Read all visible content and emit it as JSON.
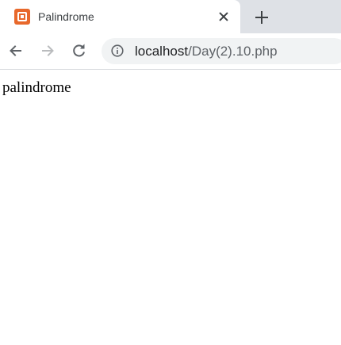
{
  "tab": {
    "title": "Palindrome",
    "favicon": "xampp-favicon-icon",
    "favicon_color": "#e8682b"
  },
  "toolbar": {
    "back_icon": "arrow-left-icon",
    "forward_icon": "arrow-right-icon",
    "reload_icon": "reload-icon",
    "info_icon": "info-icon",
    "url_host": "localhost",
    "url_path": "/Day(2).10.php"
  },
  "page": {
    "text": "palindrome"
  },
  "colors": {
    "tabstrip": "#dee1e6",
    "omnibox": "#f1f3f4",
    "icon": "#5f6368"
  }
}
